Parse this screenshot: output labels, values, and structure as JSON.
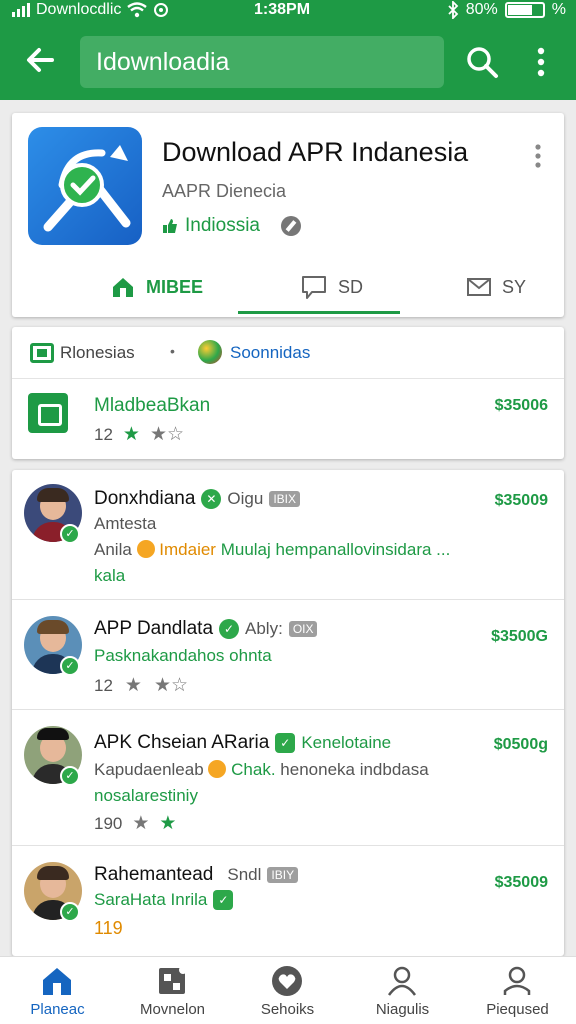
{
  "status_bar": {
    "carrier": "Downlocdlic",
    "time": "1:38PM",
    "battery": "80%",
    "battery_tail": "%"
  },
  "app_bar": {
    "search_text": "Idownloadia",
    "back_icon": "back-arrow-icon",
    "search_icon": "search-icon",
    "more_icon": "more-vert-icon"
  },
  "app_header": {
    "title": "Download APR Indanesia",
    "developer": "AAPR Dienecia",
    "subtitle": "Indiossia",
    "tabs": [
      {
        "label": "MIBEE",
        "icon": "home-icon"
      },
      {
        "label": "SD",
        "icon": "chat-icon"
      },
      {
        "label": "SY",
        "icon": "mail-icon"
      }
    ]
  },
  "featured": {
    "left_label": "Rlonesias",
    "separator": "•",
    "right_label": "Soonnidas",
    "app_name": "MladbeaBkan",
    "rating_count": "12",
    "price": "$35006"
  },
  "list": [
    {
      "name": "Donxhdiana",
      "badge_text": "Oigu",
      "tag": "IBIX",
      "price": "$35009",
      "line2": "Amtesta",
      "line3_a": "Anila",
      "line3_b": "Imdaier",
      "line3_c": "Muulaj hempanallovinsidara ...",
      "line4": "kala"
    },
    {
      "name": "APP Dandlata",
      "badge_text": "Ably:",
      "tag": "OIX",
      "price": "$3500G",
      "line2": "Pasknakandahos ohnta",
      "rating_count": "12"
    },
    {
      "name": "APK Chseian ARaria",
      "badge_text": "Kenelotaine",
      "price": "$0500g",
      "line2_a": "Kapudaenleab",
      "line2_b": "Chak.",
      "line2_c": "henoneka indbdasa",
      "line3": "nosalarestiniy",
      "rating_count": "190"
    },
    {
      "name": "Rahemantead",
      "badge_text": "Sndl",
      "tag": "IBIY",
      "price": "$35009",
      "line2": "SaraHata Inrila",
      "line3": "119"
    }
  ],
  "bottom_nav": [
    {
      "label": "Planeac",
      "icon": "home-icon"
    },
    {
      "label": "Movnelon",
      "icon": "grid-icon"
    },
    {
      "label": "Sehoiks",
      "icon": "heart-icon"
    },
    {
      "label": "Niagulis",
      "icon": "person-icon"
    },
    {
      "label": "Pieqused",
      "icon": "profile-icon"
    }
  ],
  "colors": {
    "primary_green": "#1e9a45",
    "accent_blue": "#1565c0",
    "price_green": "#1e9a45"
  }
}
